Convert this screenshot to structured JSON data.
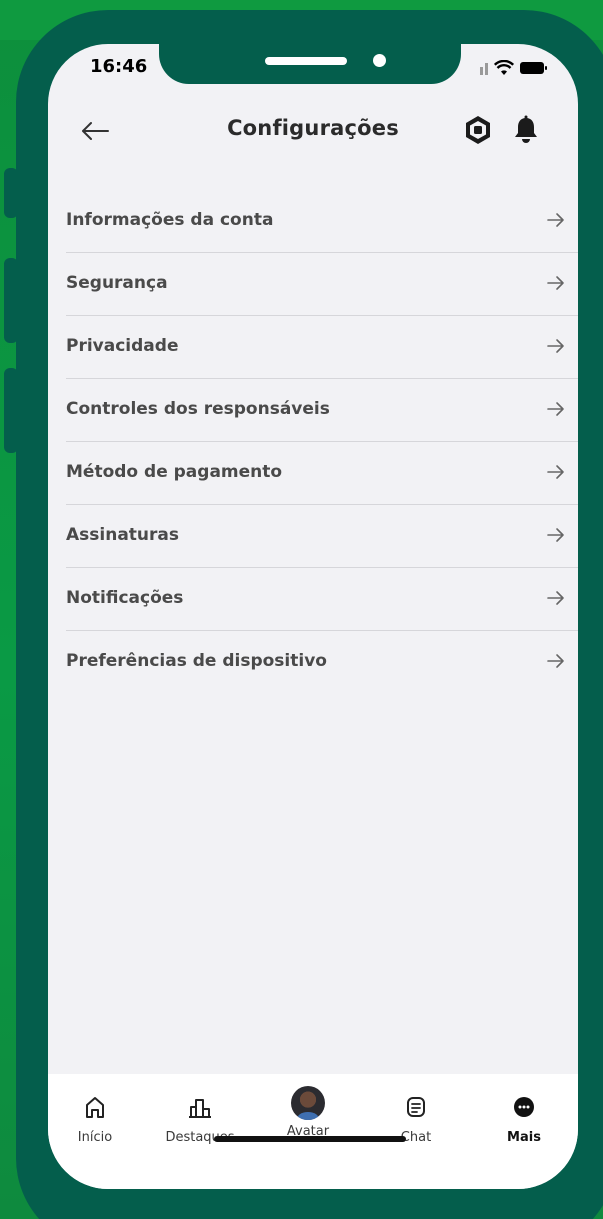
{
  "status_bar": {
    "time": "16:46"
  },
  "header": {
    "title": "Configurações",
    "back_icon": "arrow-left-icon",
    "robux_icon": "robux-icon",
    "bell_icon": "bell-icon"
  },
  "settings": {
    "items": [
      {
        "label": "Informações da conta"
      },
      {
        "label": "Segurança"
      },
      {
        "label": "Privacidade"
      },
      {
        "label": "Controles dos responsáveis"
      },
      {
        "label": "Método de pagamento"
      },
      {
        "label": "Assinaturas"
      },
      {
        "label": "Notificações"
      },
      {
        "label": "Preferências de dispositivo"
      }
    ]
  },
  "bottom_nav": {
    "items": [
      {
        "label": "Início",
        "icon": "home-icon"
      },
      {
        "label": "Destaques",
        "icon": "charts-icon"
      },
      {
        "label": "Avatar",
        "icon": "avatar-icon"
      },
      {
        "label": "Chat",
        "icon": "chat-icon"
      },
      {
        "label": "Mais",
        "icon": "more-icon",
        "active": true
      }
    ]
  },
  "colors": {
    "background_green": "#0d8f3c",
    "phone_frame": "#045e4c",
    "screen_bg": "#f2f2f5",
    "text_primary": "#2b2b2b",
    "text_item": "#4a4a4a"
  }
}
